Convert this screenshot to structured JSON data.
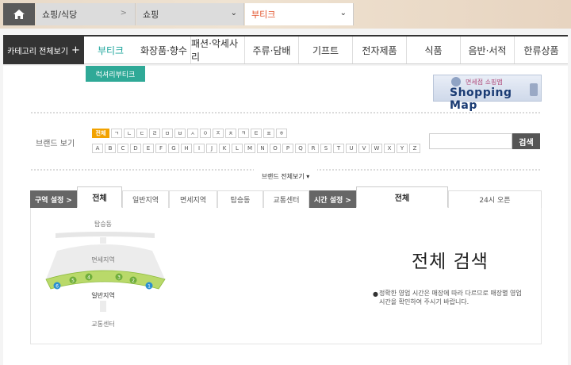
{
  "breadcrumb": {
    "home_icon": "home-icon",
    "level1": "쇼핑/식당",
    "level1_arrow": ">",
    "level2": "쇼핑",
    "level2_chevron": "⌄",
    "level3": "부티크",
    "level3_chevron": "⌄"
  },
  "category_nav": {
    "all_label": "카테고리 전체보기",
    "all_icon": "+",
    "items": [
      "부티크",
      "화장품·향수",
      "패션·악세사리",
      "주류·담배",
      "기프트",
      "전자제품",
      "식품",
      "음반·서적",
      "한류상품"
    ],
    "active_index": 0,
    "sub_tab": "럭셔리부티크"
  },
  "shopping_map": {
    "top_text": "면세점 쇼핑맵",
    "main_text": "Shopping Map"
  },
  "brand_filter": {
    "label": "브랜드 보기",
    "korean_chips": [
      "전체",
      "ㄱ",
      "ㄴ",
      "ㄷ",
      "ㄹ",
      "ㅁ",
      "ㅂ",
      "ㅅ",
      "ㅇ",
      "ㅈ",
      "ㅊ",
      "ㅋ",
      "ㅌ",
      "ㅍ",
      "ㅎ"
    ],
    "alpha_chips": [
      "A",
      "B",
      "C",
      "D",
      "E",
      "F",
      "G",
      "H",
      "I",
      "J",
      "K",
      "L",
      "M",
      "N",
      "O",
      "P",
      "Q",
      "R",
      "S",
      "T",
      "U",
      "V",
      "W",
      "X",
      "Y",
      "Z"
    ],
    "search_placeholder": "",
    "search_button": "검색",
    "toggle_label": "브랜드 전체보기 ▾"
  },
  "zone_tabs": {
    "zone_setting": "구역 설정 >",
    "zones": [
      "전체",
      "일반지역",
      "면세지역",
      "탑승동",
      "교통센터"
    ],
    "time_setting": "시간 설정 >",
    "times": [
      "전체",
      "24시 오픈"
    ]
  },
  "zone_map": {
    "labels": {
      "top": "탑승동",
      "middle": "면세지역",
      "general": "일반지역",
      "bottom": "교통센터"
    },
    "gate_numbers": [
      "6",
      "5",
      "4",
      "3",
      "2",
      "1"
    ],
    "colors": {
      "general_zone": "#b9d96a",
      "gate_dot": "#6fae3b",
      "gate_dot_active": "#2a8fd0",
      "building": "#e9e9e9"
    }
  },
  "result": {
    "title": "전체 검색",
    "notice": "정확한 영업 시간은 매장에 따라 다르므로 매장별 영업시간을 확인하여 주시기 바랍니다."
  }
}
